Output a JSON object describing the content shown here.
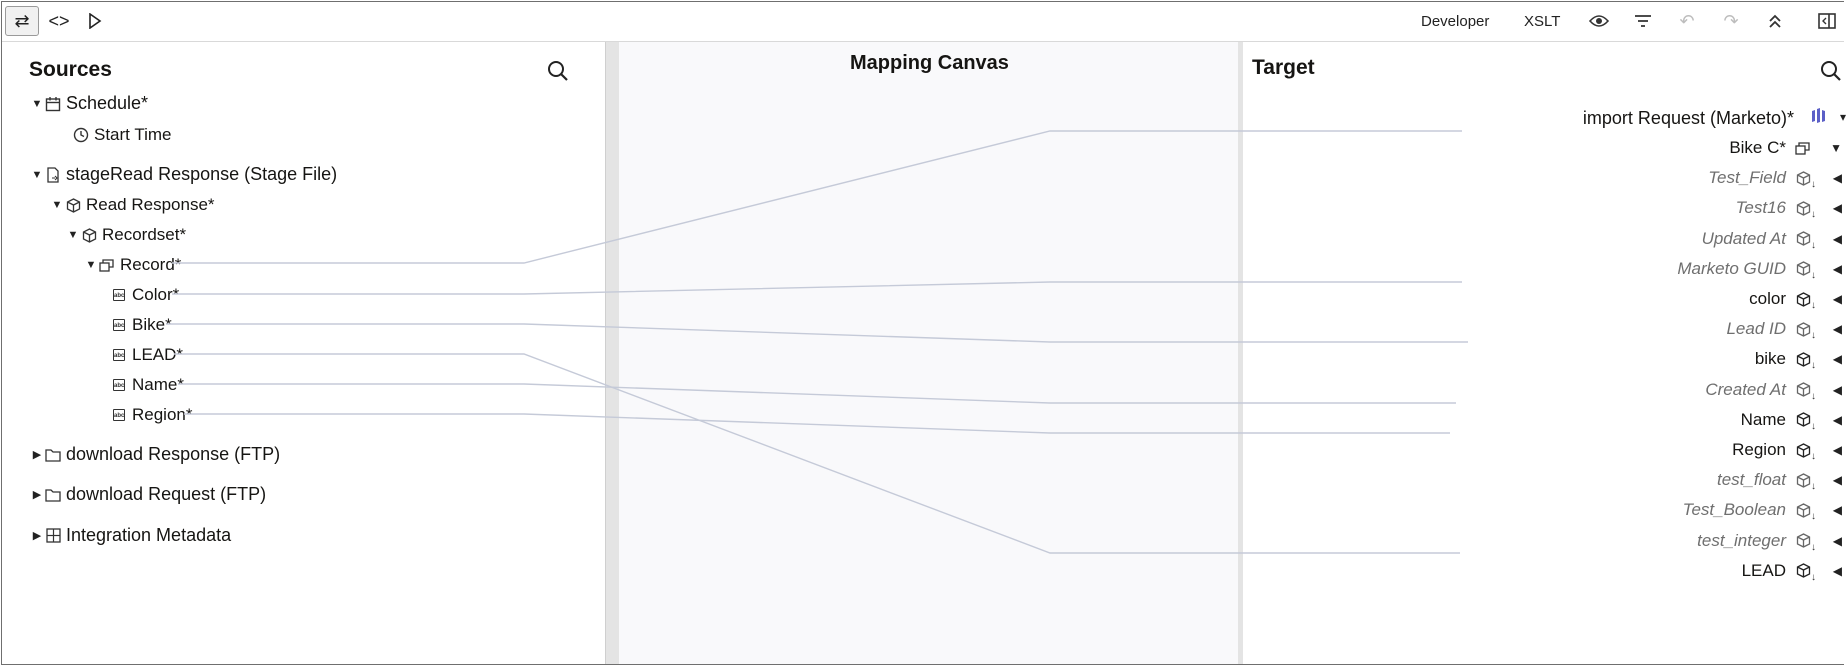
{
  "toolbar": {
    "developer_label": "Developer",
    "xslt_label": "XSLT"
  },
  "sources": {
    "title": "Sources",
    "tree": [
      {
        "label": "Schedule*",
        "icon": "calendar-icon"
      },
      {
        "label": "Start Time",
        "icon": "clock-icon"
      },
      {
        "label": "stageRead Response (Stage File)",
        "icon": "file-icon"
      },
      {
        "label": "Read Response*",
        "icon": "cube-icon"
      },
      {
        "label": "Recordset*",
        "icon": "cube-icon"
      },
      {
        "label": "Record*",
        "icon": "collection-icon"
      },
      {
        "label": "Color*",
        "icon": "string-field-icon"
      },
      {
        "label": "Bike*",
        "icon": "string-field-icon"
      },
      {
        "label": "LEAD*",
        "icon": "string-field-icon"
      },
      {
        "label": "Name*",
        "icon": "string-field-icon"
      },
      {
        "label": "Region*",
        "icon": "string-field-icon"
      },
      {
        "label": "download Response (FTP)",
        "icon": "folder-icon"
      },
      {
        "label": "download Request (FTP)",
        "icon": "folder-icon"
      },
      {
        "label": "Integration Metadata",
        "icon": "metadata-icon"
      }
    ]
  },
  "canvas": {
    "title": "Mapping Canvas"
  },
  "target": {
    "title": "Target",
    "root": "import Request (Marketo)*",
    "tree": [
      {
        "label": "Bike C*",
        "mapped": true
      },
      {
        "label": "Test_Field",
        "mapped": false
      },
      {
        "label": "Test16",
        "mapped": false
      },
      {
        "label": "Updated At",
        "mapped": false
      },
      {
        "label": "Marketo GUID",
        "mapped": false
      },
      {
        "label": "color",
        "mapped": true
      },
      {
        "label": "Lead ID",
        "mapped": false
      },
      {
        "label": "bike",
        "mapped": true
      },
      {
        "label": "Created At",
        "mapped": false
      },
      {
        "label": "Name",
        "mapped": true
      },
      {
        "label": "Region",
        "mapped": true
      },
      {
        "label": "test_float",
        "mapped": false
      },
      {
        "label": "Test_Boolean",
        "mapped": false
      },
      {
        "label": "test_integer",
        "mapped": false
      },
      {
        "label": "LEAD",
        "mapped": true
      }
    ]
  },
  "colors": {
    "mapping_line": "#c5cad8",
    "accent": "#5b5fc7"
  }
}
